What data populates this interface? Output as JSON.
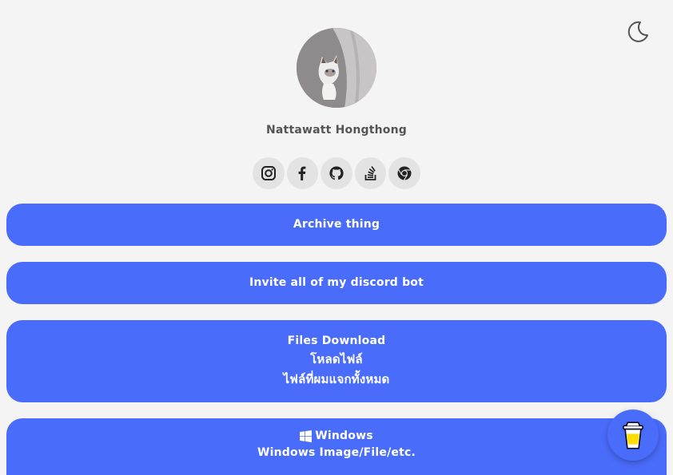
{
  "profile": {
    "name": "Nattawatt Hongthong",
    "avatar_icon": "cat-avatar"
  },
  "theme_toggle": {
    "icon": "moon-icon"
  },
  "socials": [
    {
      "icon": "instagram-icon"
    },
    {
      "icon": "facebook-icon"
    },
    {
      "icon": "github-icon"
    },
    {
      "icon": "stackoverflow-icon"
    },
    {
      "icon": "chrome-icon"
    }
  ],
  "links": {
    "archive": {
      "label": "Archive thing"
    },
    "discord": {
      "label": "Invite all of my discord bot"
    },
    "files": {
      "label": "Files Download",
      "line2": "โหลดไฟล์",
      "line3": "ไฟล์ที่ผมแจกทั้งหมด"
    },
    "windows": {
      "label": "Windows",
      "line2": "Windows Image/File/etc.",
      "icon": "windows-icon"
    }
  },
  "buy_me_coffee": {
    "icon": "coffee-cup-icon"
  },
  "colors": {
    "background": "#f4f4f4",
    "button": "#4a6cfb",
    "button_text": "#ffffff",
    "social_bg": "#e3e3e3",
    "name_text": "#555555"
  }
}
